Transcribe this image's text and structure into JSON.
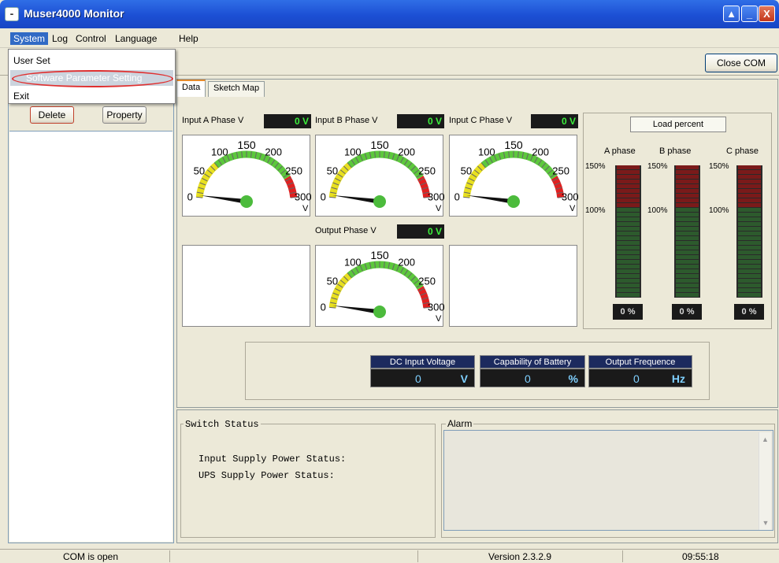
{
  "window": {
    "title": "Muser4000 Monitor",
    "minimize": "_",
    "restore": "▲",
    "close": "X"
  },
  "menu": {
    "items": [
      "System",
      "Log",
      "Control",
      "Language",
      "Help"
    ]
  },
  "dropdown": {
    "items": [
      "User Set",
      "Software Parameter Setting",
      "Exit"
    ]
  },
  "toolbar": {
    "close_com": "Close COM"
  },
  "left_panel": {
    "delete": "Delete",
    "property": "Property"
  },
  "tabs": [
    "Data",
    "Sketch Map"
  ],
  "gauges": [
    {
      "title": "Input A Phase V",
      "value": "0 V"
    },
    {
      "title": "Input B Phase V",
      "value": "0 V"
    },
    {
      "title": "Input C Phase V",
      "value": "0 V"
    },
    {
      "title": "Output Phase V",
      "value": "0 V"
    }
  ],
  "gauge_scale": {
    "ticks": [
      "0",
      "50",
      "100",
      "150",
      "200",
      "250",
      "300"
    ],
    "unit": "V",
    "colors": {
      "low": "#e8e020",
      "mid": "#5cc83c",
      "high": "#e02020",
      "needle": "#111111",
      "hub": "#4cbb3c"
    }
  },
  "load": {
    "title": "Load percent",
    "phases": [
      {
        "label": "A phase",
        "value": "0 %",
        "percent": 0
      },
      {
        "label": "B phase",
        "value": "0 %",
        "percent": 0
      },
      {
        "label": "C phase",
        "value": "0 %",
        "percent": 0
      }
    ],
    "scale_top": "150%",
    "scale_mid": "100%",
    "colors": {
      "over": "#7a1a1a",
      "normal": "#2d5a2d"
    }
  },
  "meters": [
    {
      "title": "DC Input Voltage",
      "value": "0",
      "unit": "V"
    },
    {
      "title": "Capability of Battery",
      "value": "0",
      "unit": "%"
    },
    {
      "title": "Output Frequence",
      "value": "0",
      "unit": "Hz"
    }
  ],
  "switch_status": {
    "title": "Switch Status",
    "line1": "Input Supply Power Status:",
    "line2": "UPS Supply Power Status:"
  },
  "alarm": {
    "title": "Alarm"
  },
  "status_bar": {
    "com": "COM is open",
    "version": "Version 2.3.2.9",
    "time": "09:55:18"
  }
}
